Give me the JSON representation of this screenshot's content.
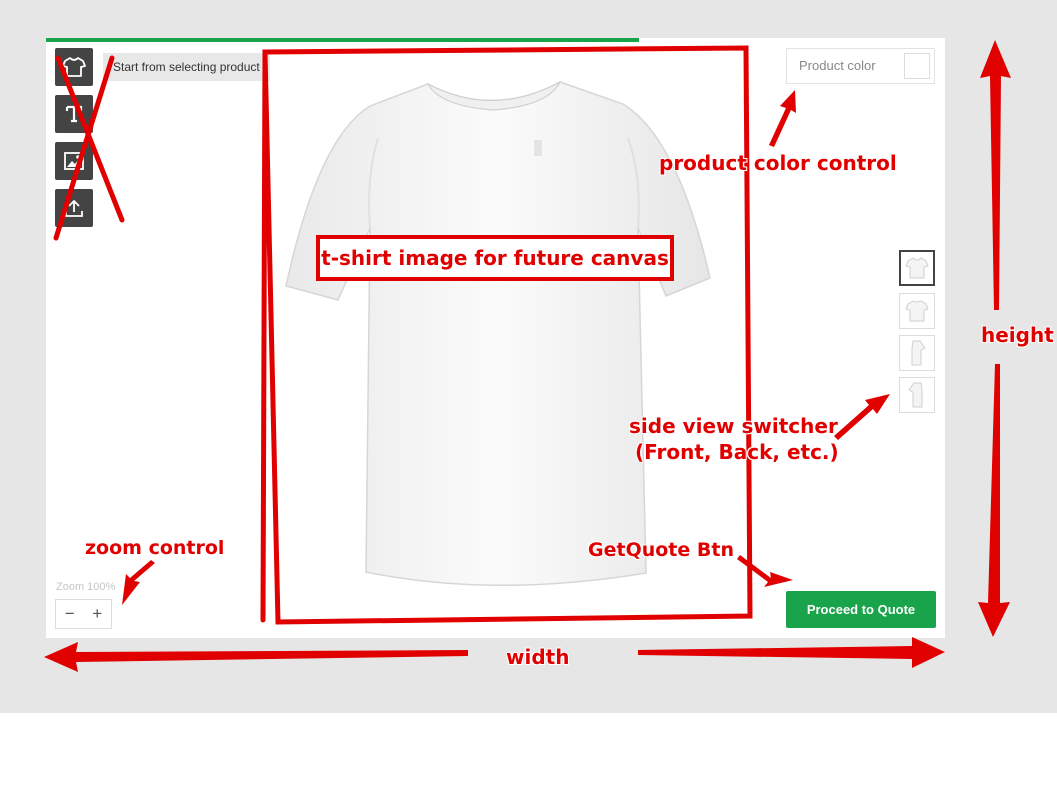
{
  "colors": {
    "accent": "#19a34a",
    "annotation": "#e00000",
    "tool_bg": "#444444"
  },
  "progress": {
    "fraction": 0.66
  },
  "toolbar": {
    "tools": [
      {
        "icon": "tshirt-icon"
      },
      {
        "icon": "text-icon"
      },
      {
        "icon": "image-icon"
      },
      {
        "icon": "upload-icon"
      }
    ],
    "tooltip": "Start from selecting product"
  },
  "product_color": {
    "label": "Product color",
    "value": "#ffffff"
  },
  "views": [
    {
      "icon": "tshirt-front-thumbnail-icon",
      "active": true
    },
    {
      "icon": "tshirt-back-thumbnail-icon",
      "active": false
    },
    {
      "icon": "tshirt-left-side-thumbnail-icon",
      "active": false
    },
    {
      "icon": "tshirt-right-side-thumbnail-icon",
      "active": false
    }
  ],
  "zoom": {
    "label": "Zoom 100%",
    "minus": "−",
    "plus": "+"
  },
  "quote": {
    "button_label": "Proceed to Quote"
  },
  "annotations": {
    "canvas": "t-shirt image for future canvas",
    "color_control": "product color control",
    "view_switcher_line1": "side view switcher",
    "view_switcher_line2": "(Front, Back, etc.)",
    "getquote": "GetQuote Btn",
    "zoom": "zoom control",
    "width": "width",
    "height": "height"
  }
}
